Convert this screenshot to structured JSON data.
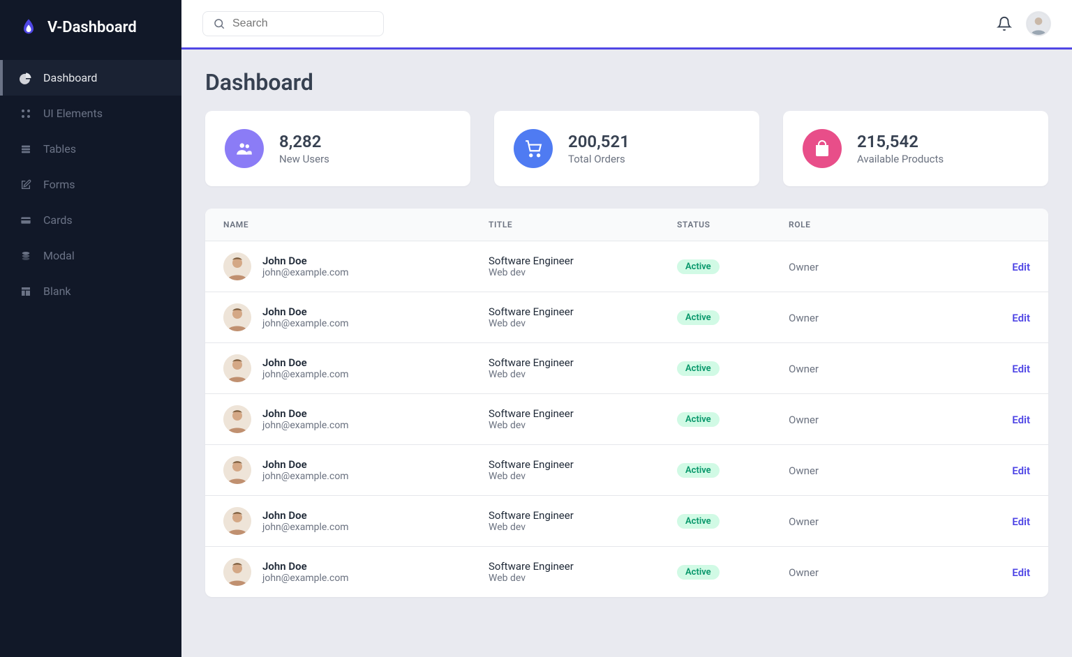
{
  "brand": {
    "name": "V-Dashboard"
  },
  "sidebar": {
    "items": [
      {
        "label": "Dashboard",
        "icon": "chart-pie-icon",
        "active": true
      },
      {
        "label": "UI Elements",
        "icon": "grid-icon",
        "active": false
      },
      {
        "label": "Tables",
        "icon": "stack-icon",
        "active": false
      },
      {
        "label": "Forms",
        "icon": "edit-icon",
        "active": false
      },
      {
        "label": "Cards",
        "icon": "card-icon",
        "active": false
      },
      {
        "label": "Modal",
        "icon": "layers-icon",
        "active": false
      },
      {
        "label": "Blank",
        "icon": "layout-icon",
        "active": false
      }
    ]
  },
  "search": {
    "placeholder": "Search"
  },
  "page": {
    "title": "Dashboard"
  },
  "stats": [
    {
      "value": "8,282",
      "label": "New Users",
      "icon": "users-icon",
      "color": "purple"
    },
    {
      "value": "200,521",
      "label": "Total Orders",
      "icon": "cart-icon",
      "color": "blue"
    },
    {
      "value": "215,542",
      "label": "Available Products",
      "icon": "bag-icon",
      "color": "pink"
    }
  ],
  "table": {
    "headers": {
      "name": "NAME",
      "title": "TITLE",
      "status": "STATUS",
      "role": "ROLE"
    },
    "edit_label": "Edit",
    "rows": [
      {
        "name": "John Doe",
        "email": "john@example.com",
        "title": "Software Engineer",
        "subtitle": "Web dev",
        "status": "Active",
        "role": "Owner"
      },
      {
        "name": "John Doe",
        "email": "john@example.com",
        "title": "Software Engineer",
        "subtitle": "Web dev",
        "status": "Active",
        "role": "Owner"
      },
      {
        "name": "John Doe",
        "email": "john@example.com",
        "title": "Software Engineer",
        "subtitle": "Web dev",
        "status": "Active",
        "role": "Owner"
      },
      {
        "name": "John Doe",
        "email": "john@example.com",
        "title": "Software Engineer",
        "subtitle": "Web dev",
        "status": "Active",
        "role": "Owner"
      },
      {
        "name": "John Doe",
        "email": "john@example.com",
        "title": "Software Engineer",
        "subtitle": "Web dev",
        "status": "Active",
        "role": "Owner"
      },
      {
        "name": "John Doe",
        "email": "john@example.com",
        "title": "Software Engineer",
        "subtitle": "Web dev",
        "status": "Active",
        "role": "Owner"
      },
      {
        "name": "John Doe",
        "email": "john@example.com",
        "title": "Software Engineer",
        "subtitle": "Web dev",
        "status": "Active",
        "role": "Owner"
      }
    ]
  },
  "colors": {
    "accent": "#5046e5",
    "sidebar_bg": "#111828",
    "purple": "#8b7cf6",
    "blue": "#4f7bf2",
    "pink": "#e84e89",
    "badge_bg": "#d1fae5",
    "badge_text": "#059669"
  }
}
